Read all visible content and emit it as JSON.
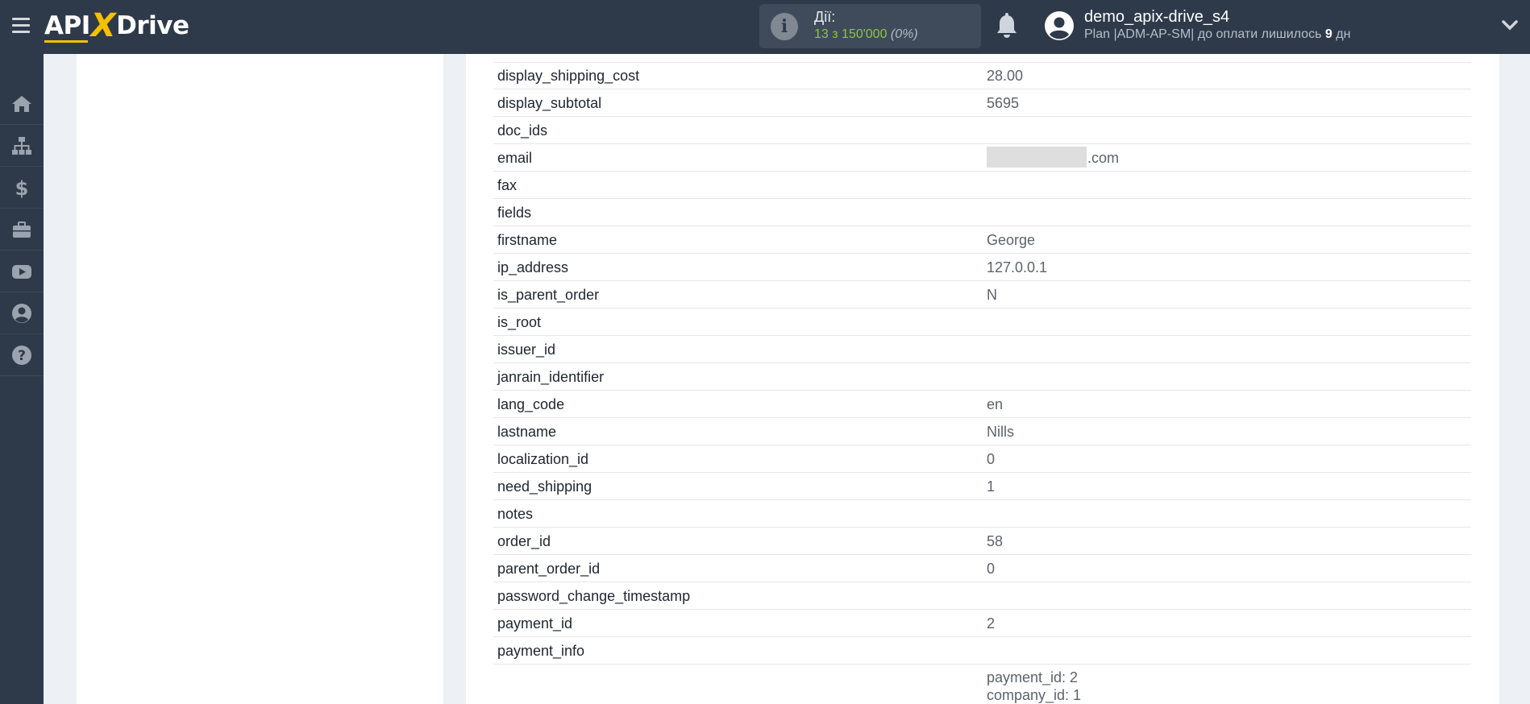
{
  "header": {
    "logo_left": "API",
    "logo_x": "X",
    "logo_right": "Drive",
    "actions_label": "Дії:",
    "actions_count": "13 з 150'000",
    "actions_percent": "(0%)",
    "user_name": "demo_apix-drive_s4",
    "plan_text": "Plan |ADM-AP-SM| до оплати лишилось",
    "plan_days": "9",
    "plan_unit": "дн"
  },
  "sidebar": {
    "items": [
      {
        "icon": "home-icon"
      },
      {
        "icon": "sitemap-icon"
      },
      {
        "icon": "dollar-icon"
      },
      {
        "icon": "briefcase-icon"
      },
      {
        "icon": "youtube-icon"
      },
      {
        "icon": "user-circle-icon"
      },
      {
        "icon": "help-icon"
      }
    ]
  },
  "fields": [
    {
      "key": "display_shipping_cost",
      "value": "28.00"
    },
    {
      "key": "display_subtotal",
      "value": "5695"
    },
    {
      "key": "doc_ids",
      "value": ""
    },
    {
      "key": "email",
      "value": ".com"
    },
    {
      "key": "fax",
      "value": ""
    },
    {
      "key": "fields",
      "value": ""
    },
    {
      "key": "firstname",
      "value": "George"
    },
    {
      "key": "ip_address",
      "value": "127.0.0.1"
    },
    {
      "key": "is_parent_order",
      "value": "N"
    },
    {
      "key": "is_root",
      "value": ""
    },
    {
      "key": "issuer_id",
      "value": ""
    },
    {
      "key": "janrain_identifier",
      "value": ""
    },
    {
      "key": "lang_code",
      "value": "en"
    },
    {
      "key": "lastname",
      "value": "Nills"
    },
    {
      "key": "localization_id",
      "value": "0"
    },
    {
      "key": "need_shipping",
      "value": "1"
    },
    {
      "key": "notes",
      "value": ""
    },
    {
      "key": "order_id",
      "value": "58"
    },
    {
      "key": "parent_order_id",
      "value": "0"
    },
    {
      "key": "password_change_timestamp",
      "value": ""
    },
    {
      "key": "payment_id",
      "value": "2"
    },
    {
      "key": "payment_info",
      "value": ""
    }
  ],
  "payment_info_lines": [
    "payment_id: 2",
    "company_id: 1"
  ],
  "colors": {
    "topbar": "#2e3a4a",
    "accent": "#f6c000",
    "actions_green": "#8cc63f"
  }
}
